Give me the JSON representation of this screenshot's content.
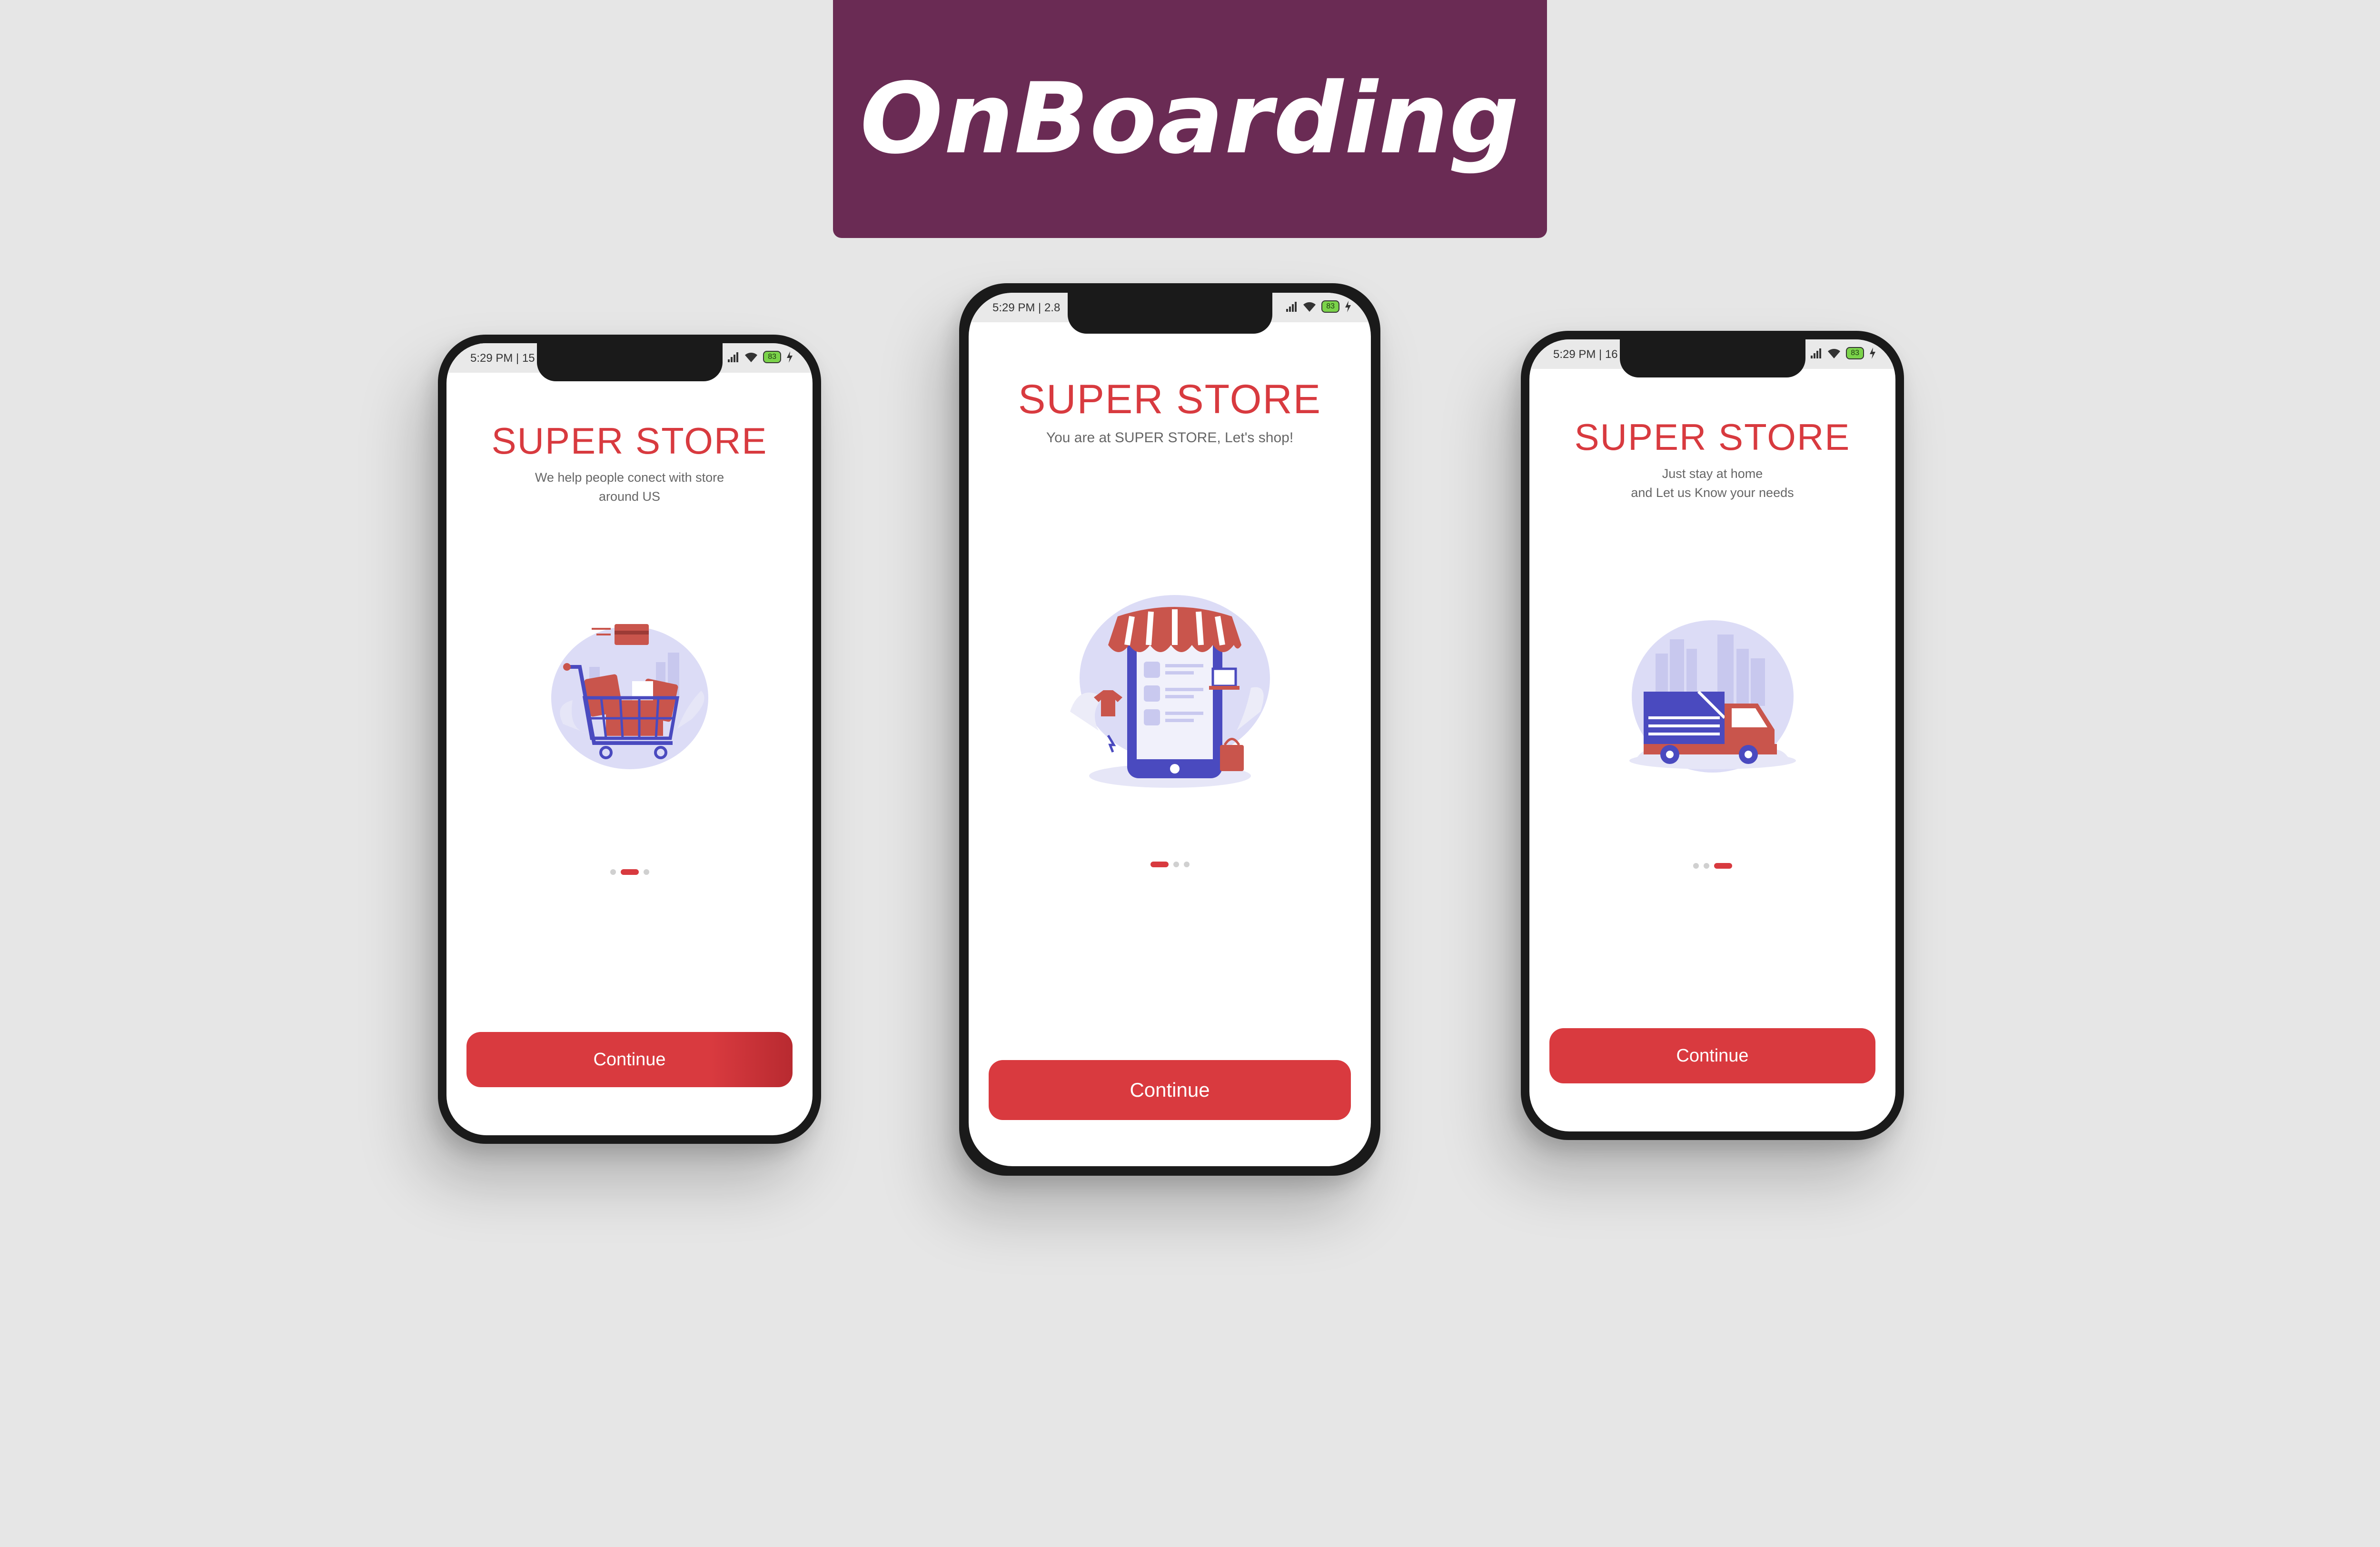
{
  "banner": {
    "title": "OnBoarding"
  },
  "colors": {
    "banner_bg": "#6a2b54",
    "brand_red": "#d83a3f",
    "illustration_purple": "#4a4abf",
    "background": "#e6e6e6"
  },
  "phones": [
    {
      "status_time": "5:29 PM | 15",
      "battery": "83",
      "title": "SUPER STORE",
      "subtitle": "We help people conect with store around US",
      "illustration_icon": "shopping-cart-icon",
      "page_indicator": {
        "total": 3,
        "active": 2
      },
      "button_label": "Continue"
    },
    {
      "status_time": "5:29 PM | 2.8",
      "battery": "83",
      "title": "SUPER STORE",
      "subtitle": "You are at SUPER STORE, Let's shop!",
      "illustration_icon": "mobile-store-icon",
      "page_indicator": {
        "total": 3,
        "active": 1
      },
      "button_label": "Continue"
    },
    {
      "status_time": "5:29 PM | 16",
      "battery": "83",
      "title": "SUPER STORE",
      "subtitle_line1": "Just stay at home",
      "subtitle_line2": "and Let us Know your needs",
      "illustration_icon": "delivery-truck-icon",
      "page_indicator": {
        "total": 3,
        "active": 3
      },
      "button_label": "Continue"
    }
  ]
}
